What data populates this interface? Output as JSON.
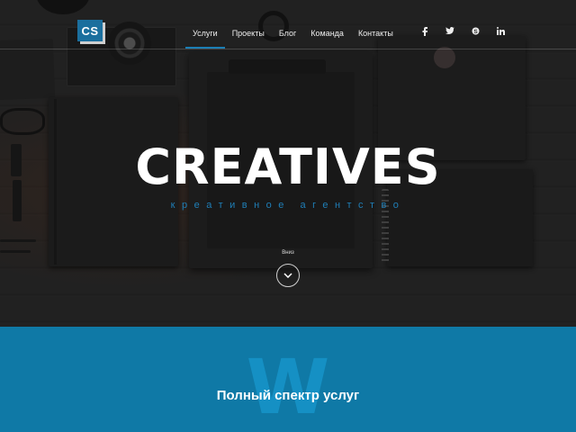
{
  "brand": {
    "logo_text": "CS"
  },
  "nav": {
    "items": [
      {
        "label": "Услуги",
        "active": true
      },
      {
        "label": "Проекты",
        "active": false
      },
      {
        "label": "Блог",
        "active": false
      },
      {
        "label": "Команда",
        "active": false
      },
      {
        "label": "Контакты",
        "active": false
      }
    ]
  },
  "social": {
    "items": [
      {
        "icon": "facebook-icon",
        "glyph": "f"
      },
      {
        "icon": "twitter-icon",
        "glyph": "t"
      },
      {
        "icon": "skype-icon",
        "glyph": "S"
      },
      {
        "icon": "linkedin-icon",
        "glyph": "in"
      }
    ]
  },
  "hero": {
    "title": "CREATIVES",
    "subtitle": "креативное агентство",
    "scroll_label": "Вниз"
  },
  "services": {
    "watermark": "W",
    "title": "Полный спектр услуг"
  },
  "colors": {
    "accent": "#1b7fb5",
    "section_blue": "#0f79a6",
    "logo_bg": "#1b6f9e"
  }
}
